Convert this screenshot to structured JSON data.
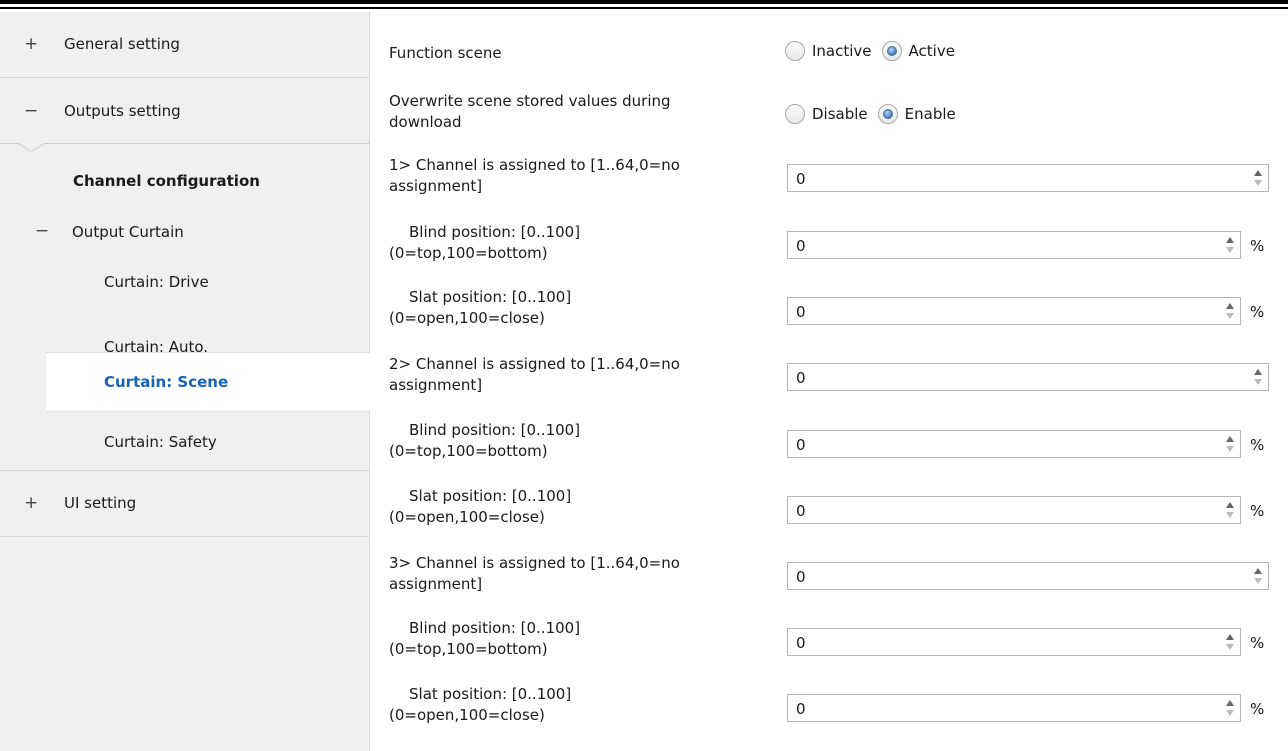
{
  "sidebar": {
    "general_setting": {
      "sign": "+",
      "label": "General setting"
    },
    "outputs_setting": {
      "sign": "−",
      "label": "Outputs setting"
    },
    "channel_configuration": "Channel configuration",
    "output_curtain": {
      "sign": "−",
      "label": "Output Curtain"
    },
    "curtain_drive": "Curtain: Drive",
    "curtain_auto": "Curtain: Auto.",
    "curtain_scene": "Curtain: Scene",
    "curtain_safety": "Curtain: Safety",
    "ui_setting": {
      "sign": "+",
      "label": "UI setting"
    }
  },
  "main": {
    "function_scene": {
      "label": "Function scene",
      "options": [
        "Inactive",
        "Active"
      ],
      "selected": "Active"
    },
    "overwrite": {
      "label_line1": "Overwrite scene stored values during",
      "label_line2": "download",
      "options": [
        "Disable",
        "Enable"
      ],
      "selected": "Enable"
    },
    "channels": [
      {
        "assigned_line1": "1> Channel is assigned to [1..64,0=no",
        "assigned_line2": "assignment]",
        "assigned_value": "0",
        "blind_line1": "Blind position: [0..100]",
        "blind_line2": "(0=top,100=bottom)",
        "blind_value": "0",
        "slat_line1": "Slat position: [0..100]",
        "slat_line2": "(0=open,100=close)",
        "slat_value": "0"
      },
      {
        "assigned_line1": "2> Channel is assigned to [1..64,0=no",
        "assigned_line2": "assignment]",
        "assigned_value": "0",
        "blind_line1": "Blind position: [0..100]",
        "blind_line2": "(0=top,100=bottom)",
        "blind_value": "0",
        "slat_line1": "Slat position: [0..100]",
        "slat_line2": "(0=open,100=close)",
        "slat_value": "0"
      },
      {
        "assigned_line1": "3> Channel is assigned to [1..64,0=no",
        "assigned_line2": "assignment]",
        "assigned_value": "0",
        "blind_line1": "Blind position: [0..100]",
        "blind_line2": "(0=top,100=bottom)",
        "blind_value": "0",
        "slat_line1": "Slat position: [0..100]",
        "slat_line2": "(0=open,100=close)",
        "slat_value": "0"
      }
    ],
    "percent_unit": "%"
  },
  "colors": {
    "sidebar_bg": "#f0f0f0",
    "selected_text": "#1a63b3",
    "radio_checked": "#3f7cc3"
  }
}
